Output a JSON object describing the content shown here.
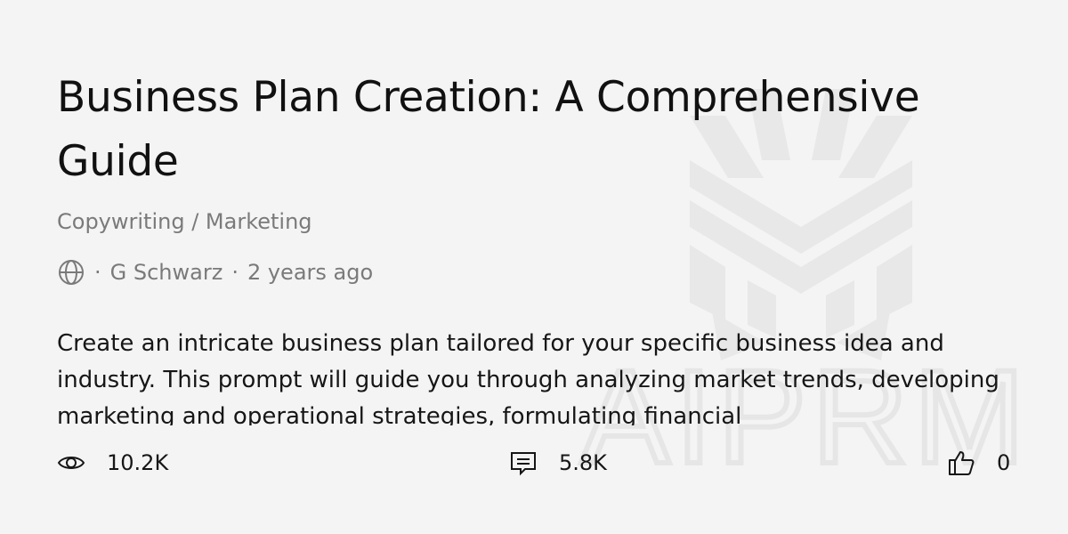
{
  "title": "Business Plan Creation: A Comprehensive Guide",
  "category": "Copywriting / Marketing",
  "meta": {
    "visibility_icon": "globe-icon",
    "separator": "·",
    "author": "G Schwarz",
    "age": "2 years ago"
  },
  "description": "Create an intricate business plan tailored for your specific business idea and industry. This prompt will guide you through analyzing market trends, developing marketing and operational strategies, formulating financial",
  "stats": {
    "views": "10.2K",
    "comments": "5.8K",
    "likes": "0"
  },
  "watermark": {
    "text": "AIPRM",
    "color": "#e9e9e9"
  },
  "colors": {
    "background": "#f4f4f4",
    "title": "#111111",
    "muted": "#7a7a7a",
    "body": "#161616"
  }
}
